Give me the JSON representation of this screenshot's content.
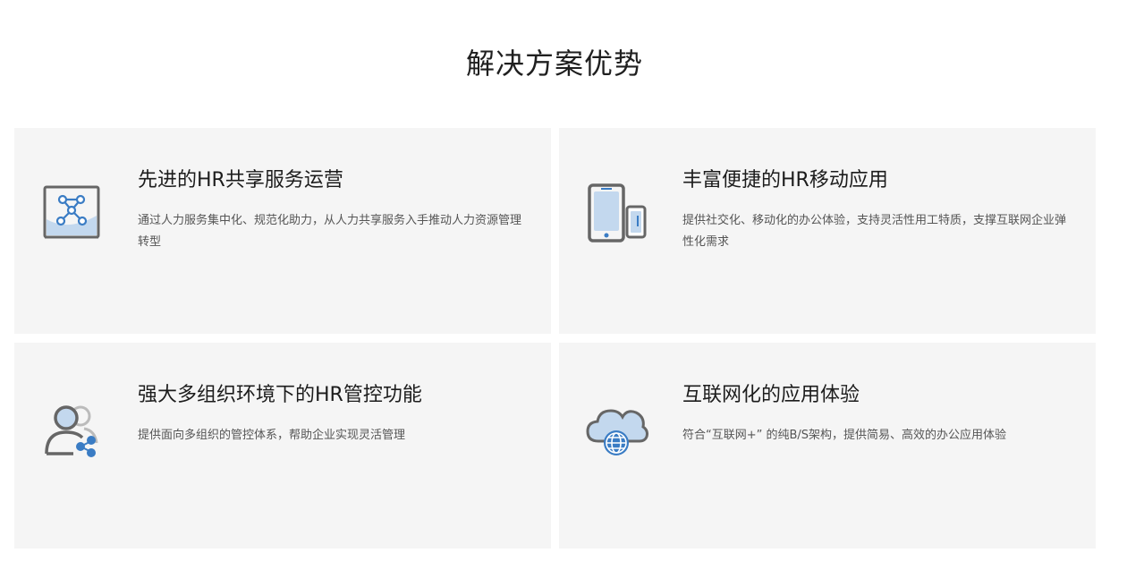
{
  "section": {
    "title": "解决方案优势"
  },
  "cards": [
    {
      "title": "先进的HR共享服务运营",
      "description": "通过人力服务集中化、规范化助力，从人力共享服务入手推动人力资源管理转型",
      "icon": "network-board-icon"
    },
    {
      "title": "丰富便捷的HR移动应用",
      "description": "提供社交化、移动化的办公体验，支持灵活性用工特质，支撑互联网企业弹性化需求",
      "icon": "mobile-devices-icon"
    },
    {
      "title": "强大多组织环境下的HR管控功能",
      "description": "提供面向多组织的管控体系，帮助企业实现灵活管理",
      "icon": "users-share-icon"
    },
    {
      "title": "互联网化的应用体验",
      "description": "符合“互联网+” 的纯B/S架构，提供简易、高效的办公应用体验",
      "icon": "cloud-globe-icon"
    }
  ],
  "colors": {
    "accent_blue": "#3a7cc4",
    "light_blue": "#c3d8ee",
    "icon_gray": "#666666",
    "card_bg": "#f5f5f5"
  }
}
